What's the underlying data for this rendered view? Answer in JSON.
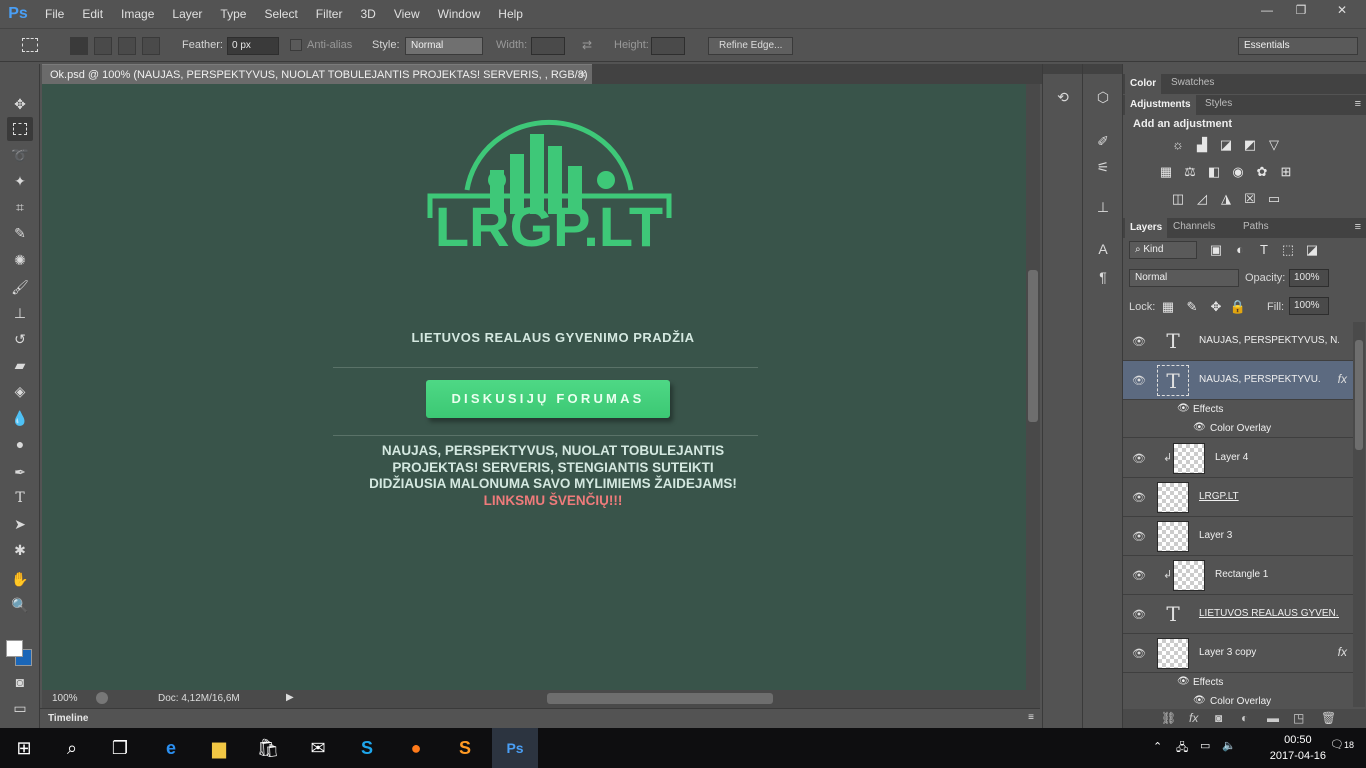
{
  "menubar": {
    "logo": "Ps",
    "items": [
      "File",
      "Edit",
      "Image",
      "Layer",
      "Type",
      "Select",
      "Filter",
      "3D",
      "View",
      "Window",
      "Help"
    ],
    "win": [
      "—",
      "❐",
      "✕"
    ]
  },
  "options": {
    "feather_label": "Feather:",
    "feather_value": "0 px",
    "antialias": "Anti-alias",
    "style_label": "Style:",
    "style_value": "Normal",
    "width_label": "Width:",
    "height_label": "Height:",
    "refine": "Refine Edge...",
    "workspace": "Essentials"
  },
  "document": {
    "tab_title": "Ok.psd @ 100% (NAUJAS, PERSPEKTYVUS, NUOLAT TOBULEJANTIS PROJEKTAS! SERVERIS, , RGB/8)",
    "close": "×"
  },
  "canvas": {
    "logo_text": "LRGP.LT",
    "subtitle": "LIETUVOS REALAUS GYVENIMO PRADŽIA",
    "button": "DISKUSIJŲ FORUMAS",
    "desc_line1": "NAUJAS, PERSPEKTYVUS, NUOLAT TOBULEJANTIS",
    "desc_line2": "PROJEKTAS! SERVERIS, STENGIANTIS SUTEIKTI",
    "desc_line3": "DIDŽIAUSIA MALONUMA SAVO MYLIMIEMS ŽAIDEJAMS!",
    "holiday": "LINKSMU ŠVENČIŲ!!!",
    "bg_color": "#39544a",
    "accent": "#3ec878"
  },
  "status": {
    "zoom": "100%",
    "doc": "Doc: 4,12M/16,6M"
  },
  "timeline_label": "Timeline",
  "panels": {
    "color_tab": "Color",
    "swatches_tab": "Swatches",
    "adjustments_tab": "Adjustments",
    "styles_tab": "Styles",
    "add_adjustment": "Add an adjustment",
    "layers_tab": "Layers",
    "channels_tab": "Channels",
    "paths_tab": "Paths",
    "kind": "Kind",
    "blend": "Normal",
    "opacity_label": "Opacity:",
    "opacity": "100%",
    "lock_label": "Lock:",
    "fill_label": "Fill:",
    "fill": "100%"
  },
  "layers": [
    {
      "name": "NAUJAS, PERSPEKTYVUS, N...",
      "type": "text"
    },
    {
      "name": "NAUJAS, PERSPEKTYVU...",
      "type": "text",
      "fx": "fx"
    },
    {
      "name": "Effects"
    },
    {
      "name": "Color Overlay"
    },
    {
      "name": "Layer 4",
      "type": "pixel"
    },
    {
      "name": "LRGP.LT",
      "type": "pixel"
    },
    {
      "name": "Layer 3",
      "type": "pixel"
    },
    {
      "name": "Rectangle 1",
      "type": "pixel"
    },
    {
      "name": "LIETUVOS REALAUS GYVEN...",
      "type": "text"
    },
    {
      "name": "Layer 3 copy",
      "type": "pixel",
      "fx": "fx"
    },
    {
      "name": "Effects"
    },
    {
      "name": "Color Overlay"
    }
  ],
  "taskbar": {
    "time": "00:50",
    "date": "2017-04-16",
    "notif": "18"
  }
}
